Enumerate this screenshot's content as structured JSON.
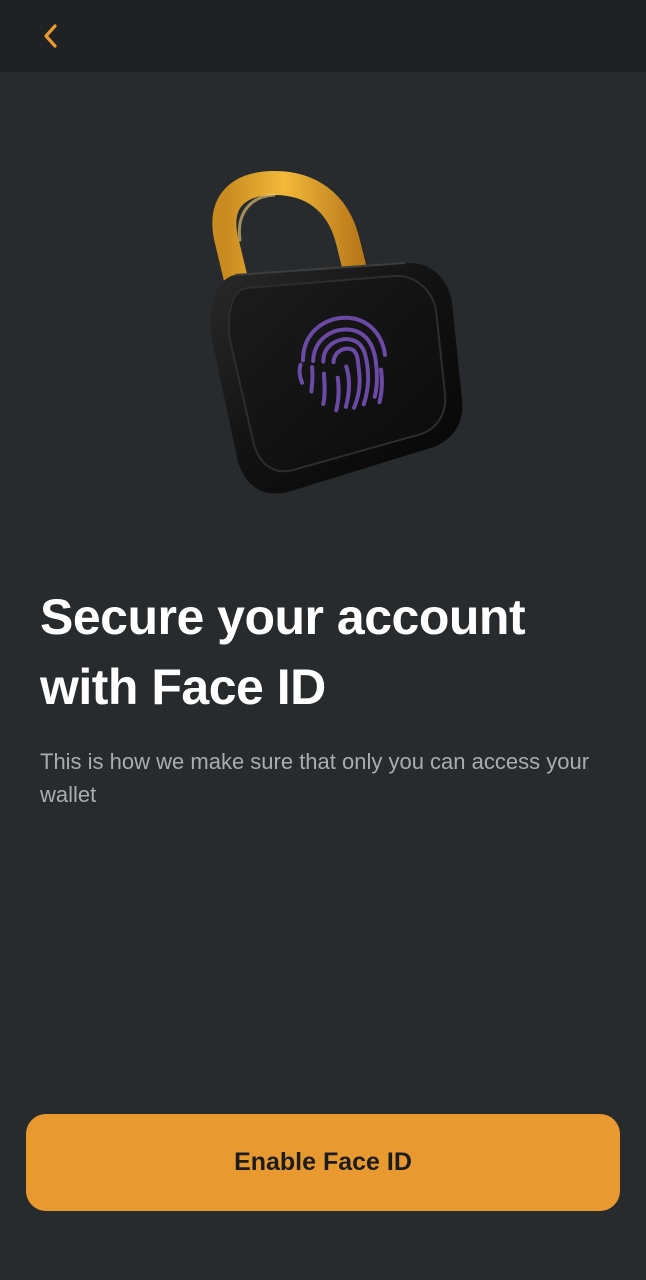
{
  "header": {
    "back_icon": "chevron-left-icon"
  },
  "hero": {
    "illustration": "padlock-fingerprint-illustration",
    "colors": {
      "shackle": "#e3a12b",
      "lock_body": "#121212",
      "fingerprint": "#6b4aa6"
    }
  },
  "content": {
    "title": "Secure your account with Face ID",
    "subtitle": "This is how we make sure that only you can access your wallet"
  },
  "actions": {
    "enable_label": "Enable Face ID"
  },
  "colors": {
    "background": "#272b2e",
    "header_background": "#1f2224",
    "accent": "#e89a30",
    "title": "#ffffff",
    "subtitle": "#a9adb1"
  }
}
